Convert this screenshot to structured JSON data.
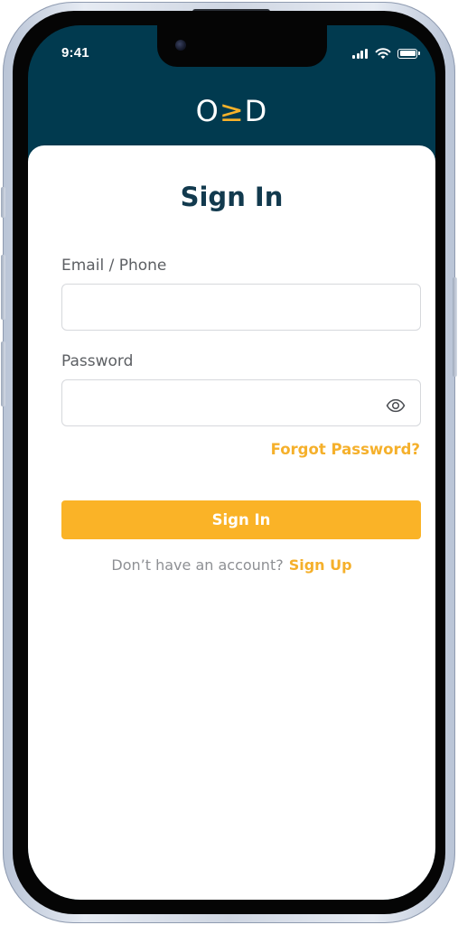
{
  "status_bar": {
    "time": "9:41"
  },
  "header": {
    "logo_left": "O",
    "logo_mid": "≥",
    "logo_right": "D"
  },
  "form": {
    "title": "Sign In",
    "email_label": "Email / Phone",
    "email_value": "",
    "password_label": "Password",
    "password_value": "",
    "forgot_password": "Forgot Password?",
    "submit_label": "Sign In",
    "signup_prompt": "Don’t have an account?",
    "signup_link": "Sign Up"
  },
  "icons": {
    "password_toggle": "eye-icon",
    "signal": "cellular-signal-icon",
    "wifi": "wifi-icon",
    "battery": "battery-icon"
  },
  "colors": {
    "header_bg": "#013a4f",
    "title": "#123a4e",
    "accent": "#fab327",
    "link": "#f5b02b"
  }
}
